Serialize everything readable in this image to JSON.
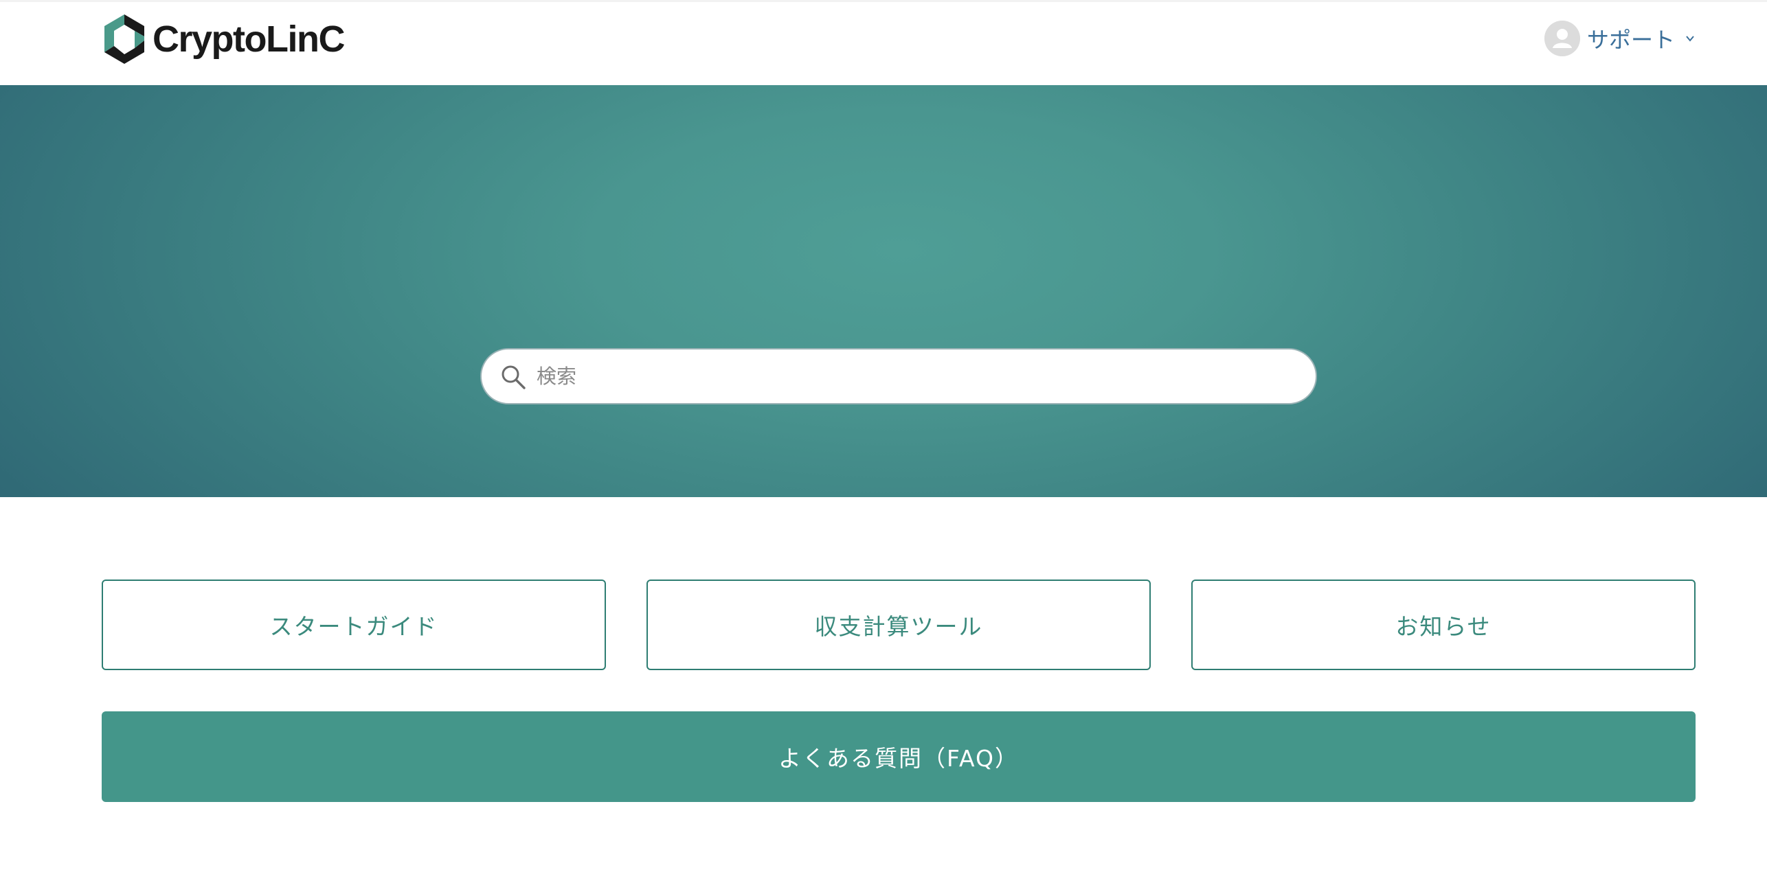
{
  "header": {
    "logo_text": "CryptoLinC",
    "logo_icon": "cryptolinc-hexagon-logo-icon",
    "user_menu": {
      "label": "サポート",
      "avatar_icon": "user-avatar-icon",
      "chevron_icon": "chevron-down-icon"
    }
  },
  "hero": {
    "search": {
      "placeholder": "検索",
      "value": "",
      "icon": "search-icon"
    }
  },
  "categories": [
    {
      "label": "スタートガイド"
    },
    {
      "label": "収支計算ツール"
    },
    {
      "label": "お知らせ"
    }
  ],
  "faq": {
    "label": "よくある質問（FAQ）"
  },
  "colors": {
    "accent": "#44968a",
    "accent_border": "#2e7d72",
    "accent_text": "#3b8a7d",
    "hero_center": "#4f9e96",
    "hero_edge": "#2e6674",
    "link_blue": "#3a6f9a"
  }
}
